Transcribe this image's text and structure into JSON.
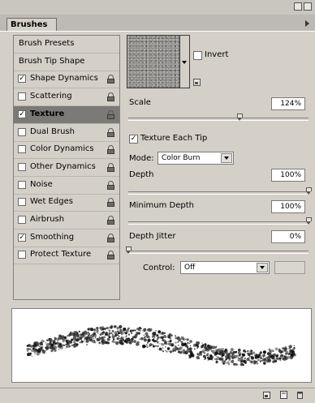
{
  "panel": {
    "tab_label": "Brushes",
    "list_items": [
      {
        "label": "Brush Presets",
        "checkbox": false,
        "checked": false,
        "locked": false,
        "selected": false
      },
      {
        "label": "Brush Tip Shape",
        "checkbox": false,
        "checked": false,
        "locked": false,
        "selected": false
      },
      {
        "label": "Shape Dynamics",
        "checkbox": true,
        "checked": true,
        "locked": true,
        "selected": false
      },
      {
        "label": "Scattering",
        "checkbox": true,
        "checked": false,
        "locked": true,
        "selected": false
      },
      {
        "label": "Texture",
        "checkbox": true,
        "checked": true,
        "locked": true,
        "selected": true
      },
      {
        "label": "Dual Brush",
        "checkbox": true,
        "checked": false,
        "locked": true,
        "selected": false
      },
      {
        "label": "Color Dynamics",
        "checkbox": true,
        "checked": false,
        "locked": true,
        "selected": false
      },
      {
        "label": "Other Dynamics",
        "checkbox": true,
        "checked": false,
        "locked": true,
        "selected": false
      },
      {
        "label": "Noise",
        "checkbox": true,
        "checked": false,
        "locked": true,
        "selected": false
      },
      {
        "label": "Wet Edges",
        "checkbox": true,
        "checked": false,
        "locked": true,
        "selected": false
      },
      {
        "label": "Airbrush",
        "checkbox": true,
        "checked": false,
        "locked": true,
        "selected": false
      },
      {
        "label": "Smoothing",
        "checkbox": true,
        "checked": true,
        "locked": true,
        "selected": false
      },
      {
        "label": "Protect Texture",
        "checkbox": true,
        "checked": false,
        "locked": true,
        "selected": false
      }
    ]
  },
  "texture": {
    "invert_label": "Invert",
    "invert_checked": false,
    "scale_label": "Scale",
    "scale_value": "124%",
    "scale_fraction": 0.62,
    "texture_each_tip_label": "Texture Each Tip",
    "texture_each_tip_checked": true,
    "mode_label": "Mode:",
    "mode_value": "Color Burn",
    "depth_label": "Depth",
    "depth_value": "100%",
    "depth_fraction": 1.0,
    "min_depth_label": "Minimum Depth",
    "min_depth_value": "100%",
    "min_depth_fraction": 1.0,
    "depth_jitter_label": "Depth Jitter",
    "depth_jitter_value": "0%",
    "depth_jitter_fraction": 0.0,
    "control_label": "Control:",
    "control_value": "Off",
    "checkmark": "✓"
  },
  "icons": {
    "panel_menu": "flyout-menu-icon",
    "lock": "lock-icon",
    "new_preset": "new-preset-icon",
    "new_brush": "new-brush-icon",
    "delete": "trash-icon"
  }
}
